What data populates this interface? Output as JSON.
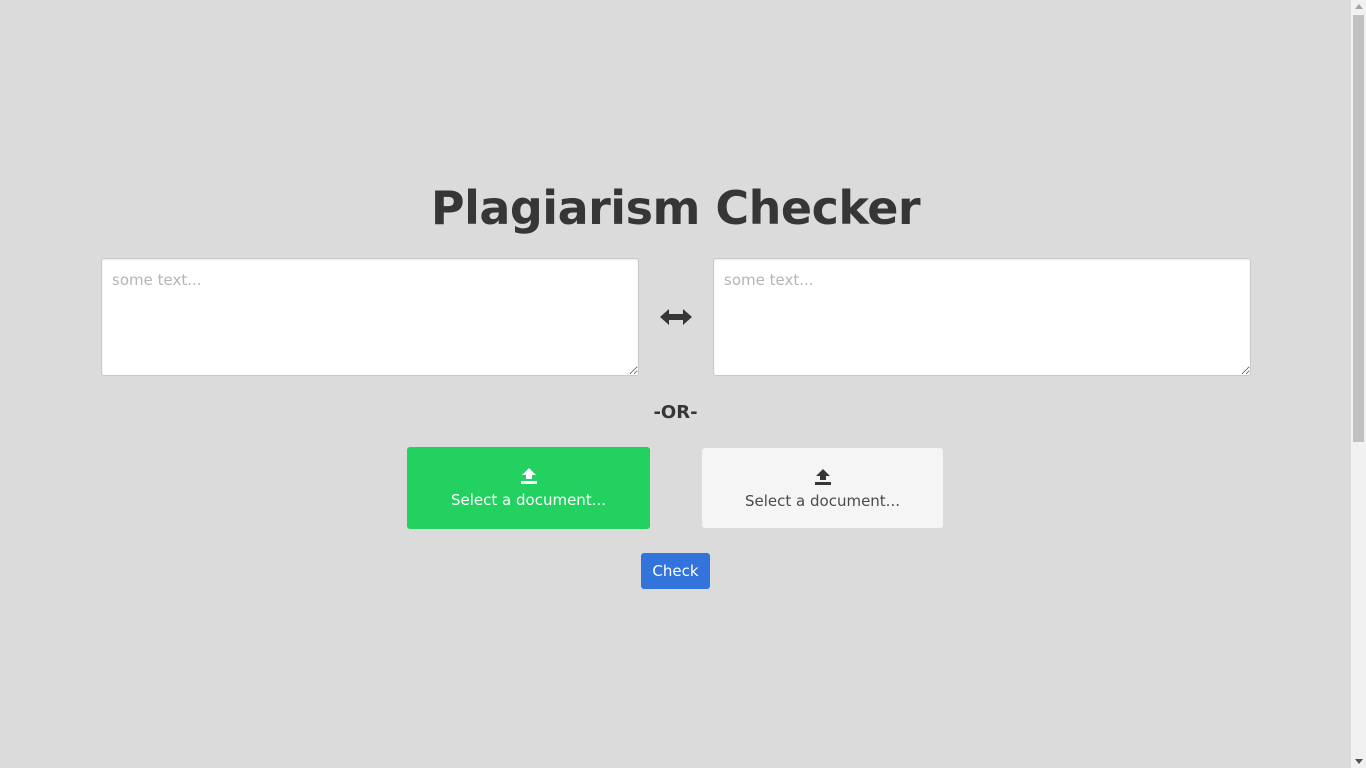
{
  "page": {
    "title": "Plagiarism Checker"
  },
  "inputs": {
    "left": {
      "value": "",
      "placeholder": "some text..."
    },
    "right": {
      "value": "",
      "placeholder": "some text..."
    }
  },
  "swap_icon": "left-right-arrow-icon",
  "divider": {
    "label": "-OR-"
  },
  "uploads": {
    "left": {
      "label": "Select a document...",
      "icon": "upload-icon",
      "color": "#23d160"
    },
    "right": {
      "label": "Select a document...",
      "icon": "upload-icon",
      "color": "#f5f5f5"
    }
  },
  "check_button": {
    "label": "Check",
    "color": "#3273dc"
  }
}
